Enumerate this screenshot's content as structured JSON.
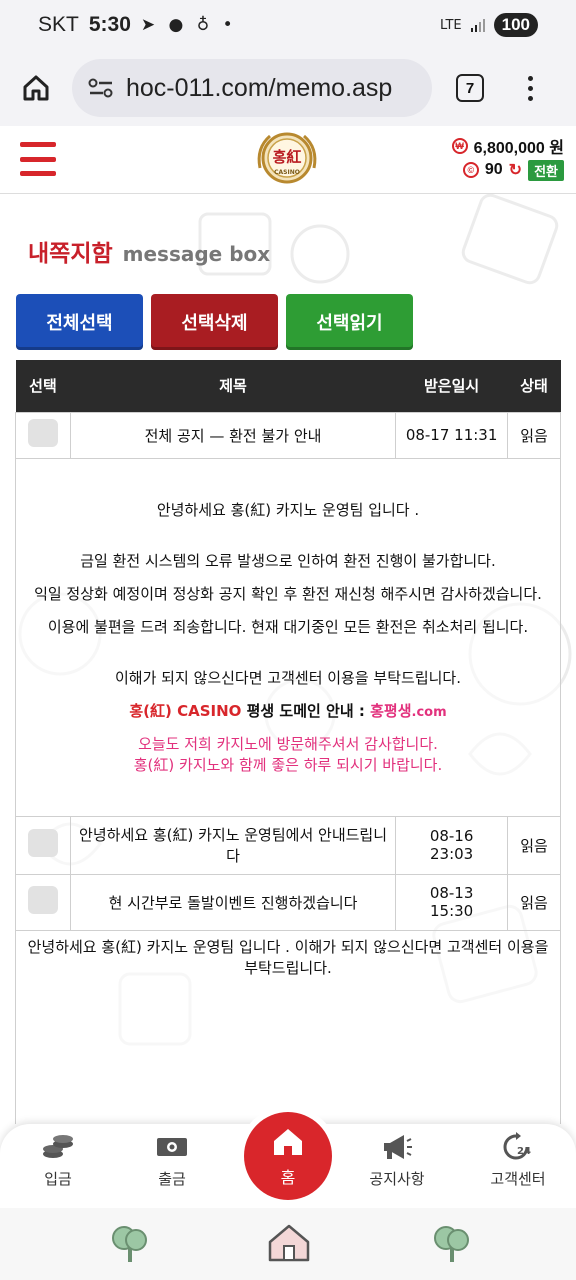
{
  "status_bar": {
    "carrier": "SKT",
    "time": "5:30",
    "network": "LTE",
    "battery": "100"
  },
  "browser": {
    "url": "hoc-011.com/memo.asp",
    "tab_count": "7"
  },
  "header": {
    "logo_text": "홍紅",
    "logo_subtext": "CASINO",
    "balance": "6,800,000 원",
    "points": "90",
    "convert_label": "전환"
  },
  "page": {
    "title_ko": "내쪽지함",
    "title_en": "message box"
  },
  "actions": {
    "select_all": "전체선택",
    "delete_selected": "선택삭제",
    "read_selected": "선택읽기"
  },
  "table": {
    "headers": {
      "select": "선택",
      "title": "제목",
      "received": "받은일시",
      "status": "상태"
    },
    "rows": [
      {
        "title": "전체 공지 — 환전 불가 안내",
        "date": "08-17 11:31",
        "status": "읽음"
      },
      {
        "title": "안녕하세요 홍(紅) 카지노 운영팀에서 안내드립니다",
        "date": "08-16 23:03",
        "status": "읽음"
      },
      {
        "title": "현 시간부로 돌발이벤트 진행하겠습니다",
        "date": "08-13 15:30",
        "status": "읽음"
      }
    ],
    "expanded_1": {
      "greeting": "안녕하세요 홍(紅) 카지노 운영팀 입니다 .",
      "line1": "금일 환전 시스템의 오류 발생으로 인하여 환전 진행이 불가합니다.",
      "line2": "익일 정상화 예정이며 정상화 공지 확인 후 환전 재신청 해주시면 감사하겠습니다.",
      "line3": "이용에 불편을 드려 죄송합니다. 현재 대기중인 모든 환전은 취소처리 됩니다.",
      "line4": "이해가 되지 않으신다면 고객센터 이용을 부탁드립니다.",
      "domain_brand": "홍(紅) CASINO",
      "domain_label": " 평생 도메인 안내 : ",
      "domain_name": "홍평생",
      "domain_tld": ".com",
      "closing1": "오늘도 저희 카지노에 방문해주셔서 감사합니다.",
      "closing2": "홍(紅) 카지노와 함께 좋은 하루 되시기 바랍니다."
    },
    "expanded_3": {
      "text": "안녕하세요 홍(紅) 카지노 운영팀 입니다 . 이해가 되지 않으신다면 고객센터 이용을 부탁드립니다."
    }
  },
  "bottom_nav": {
    "deposit": "입금",
    "withdraw": "출금",
    "home": "홈",
    "notice": "공지사항",
    "support": "고객센터"
  }
}
